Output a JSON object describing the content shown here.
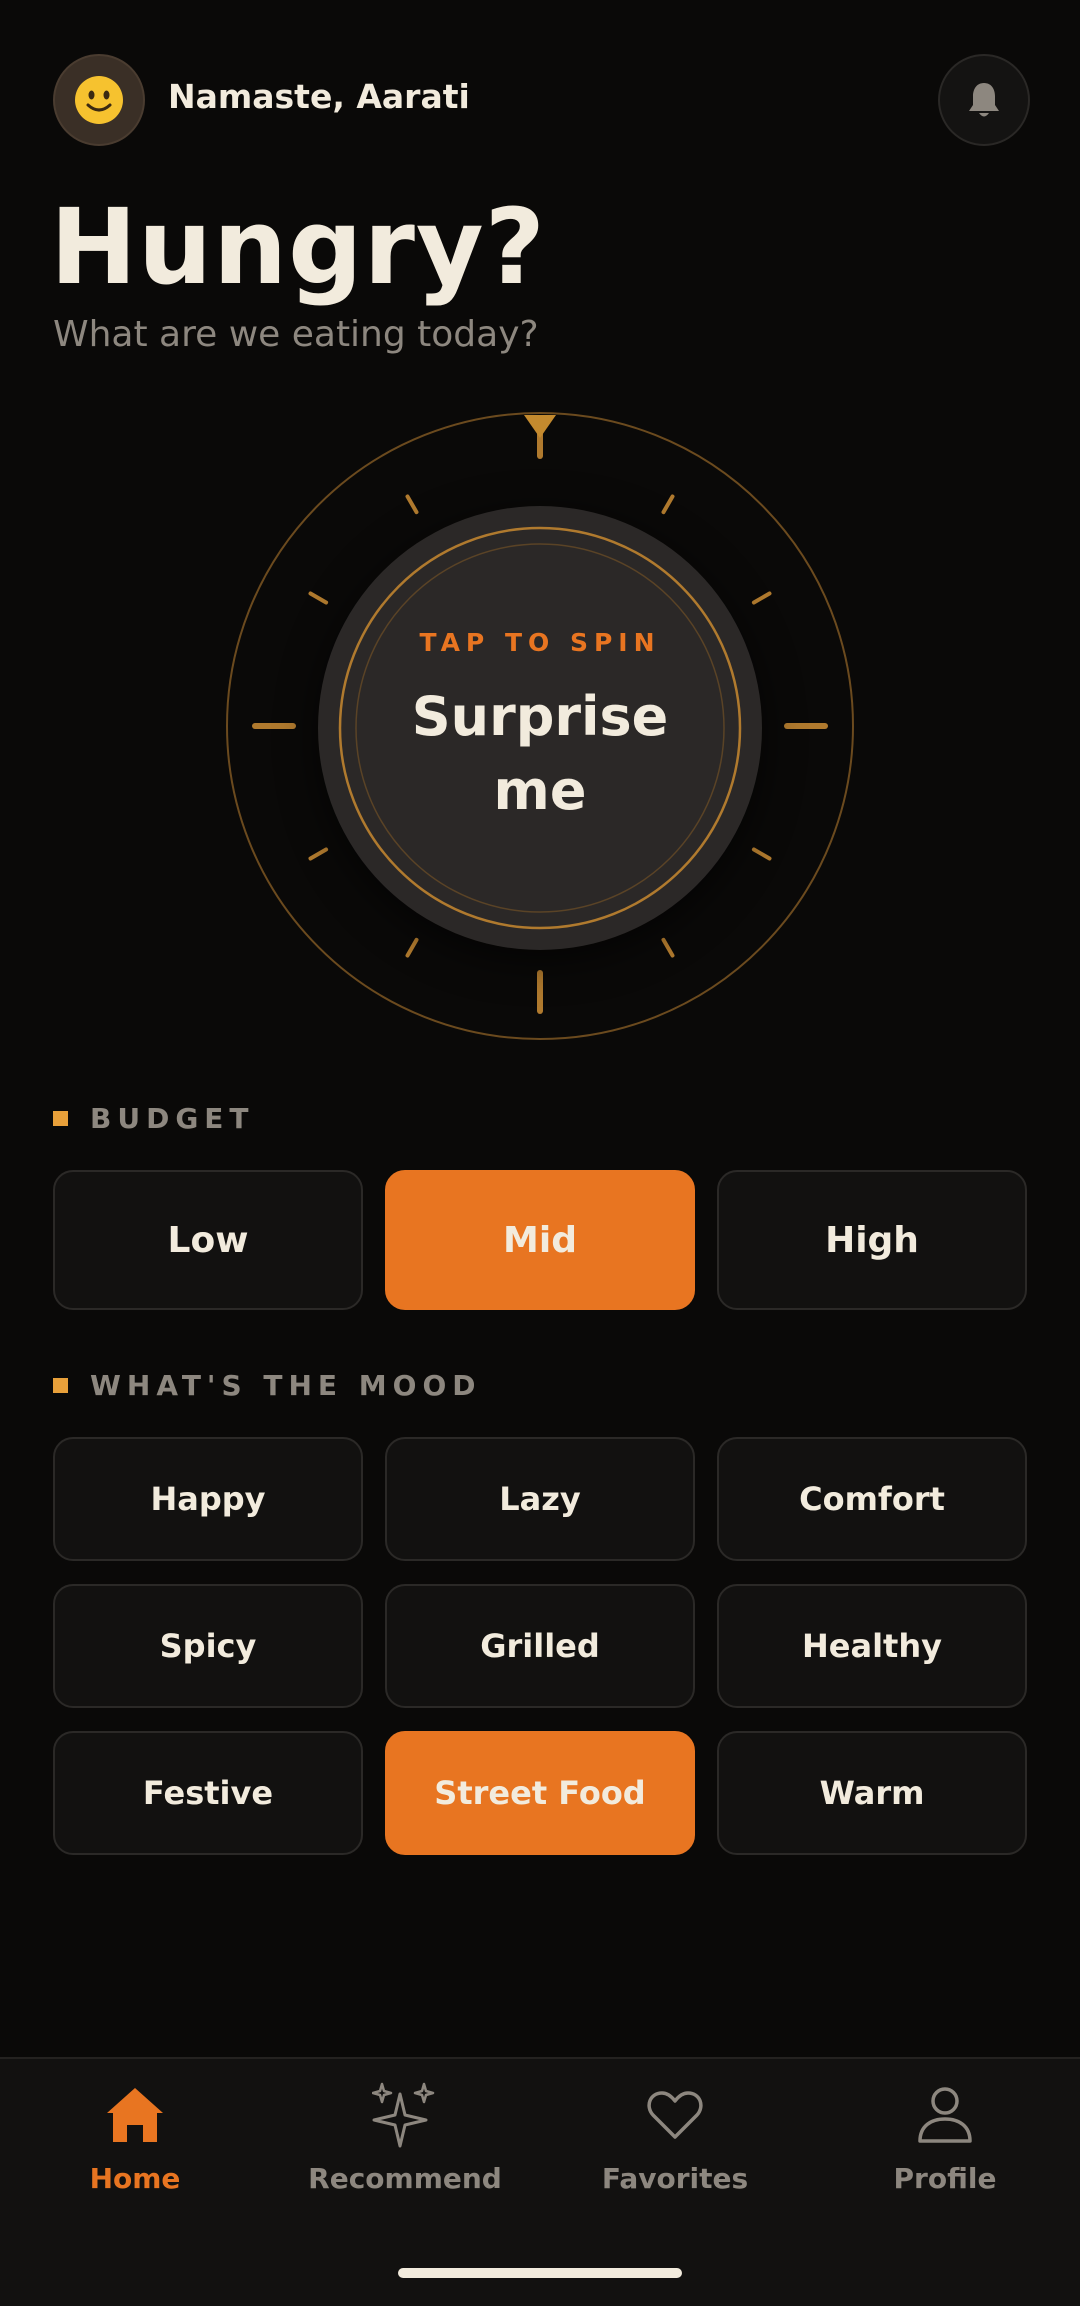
{
  "header": {
    "avatar_emoji": "🙂",
    "greeting": "Namaste, Aarati",
    "bell_icon": "bell-icon"
  },
  "hero": {
    "title": "Hungry?",
    "subtitle": "What are we eating today?"
  },
  "spinner": {
    "label": "TAP TO SPIN",
    "text": "Surprise me"
  },
  "budget": {
    "heading": "BUDGET",
    "options": [
      "Low",
      "Mid",
      "High"
    ],
    "selected": "Mid"
  },
  "mood": {
    "heading": "WHAT'S THE MOOD",
    "options": [
      "Happy",
      "Lazy",
      "Comfort",
      "Spicy",
      "Grilled",
      "Healthy",
      "Festive",
      "Street Food",
      "Warm"
    ],
    "selected": "Street Food"
  },
  "nav": {
    "items": [
      {
        "label": "Home",
        "icon": "home-icon",
        "active": true
      },
      {
        "label": "Recommend",
        "icon": "sparkles-icon",
        "active": false
      },
      {
        "label": "Favorites",
        "icon": "heart-icon",
        "active": false
      },
      {
        "label": "Profile",
        "icon": "person-icon",
        "active": false
      }
    ]
  },
  "colors": {
    "background": "#0a0908",
    "accent": "#e87521",
    "gold": "#b07a2e",
    "text": "#f2ebdd",
    "muted": "#8d877f"
  }
}
